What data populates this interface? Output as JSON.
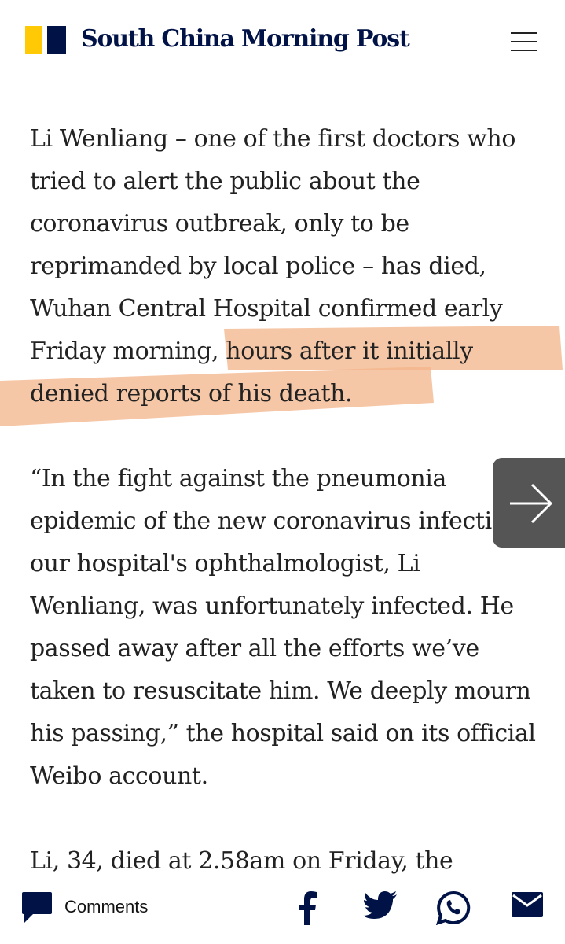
{
  "header": {
    "logo_text": "South China Morning Post",
    "logo_colors": {
      "yellow": "#FFCA05",
      "navy": "#001246"
    },
    "menu_icon": "hamburger-icon"
  },
  "article": {
    "paragraphs": [
      {
        "pre": "Li Wenliang – one of the first doctors who tried to alert the public about the coronavirus outbreak, only to be reprimanded by local police – has died, Wuhan Central Hospital confirmed early Friday morning, ",
        "highlighted": "hours after it initially denied reports of his death."
      },
      {
        "text": "“In the fight against the pneumonia epidemic of the new coronavirus infection, our hospital's ophthalmologist, Li Wenliang, was unfortunately infected. He passed away after all the efforts we’ve taken to resuscitate him. We deeply mourn his passing,” the hospital said on its official Weibo account."
      },
      {
        "text": "Li, 34, died at 2.58am on Friday, the"
      }
    ],
    "highlight_color": "#F3B48A"
  },
  "next_button": {
    "icon": "arrow-right-icon",
    "color": "#555555"
  },
  "bottom_bar": {
    "comments_label": "Comments",
    "comments_icon": "speech-bubble-icon",
    "share_icons": [
      "facebook-icon",
      "twitter-icon",
      "whatsapp-icon",
      "email-icon"
    ],
    "icon_color": "#001246"
  }
}
